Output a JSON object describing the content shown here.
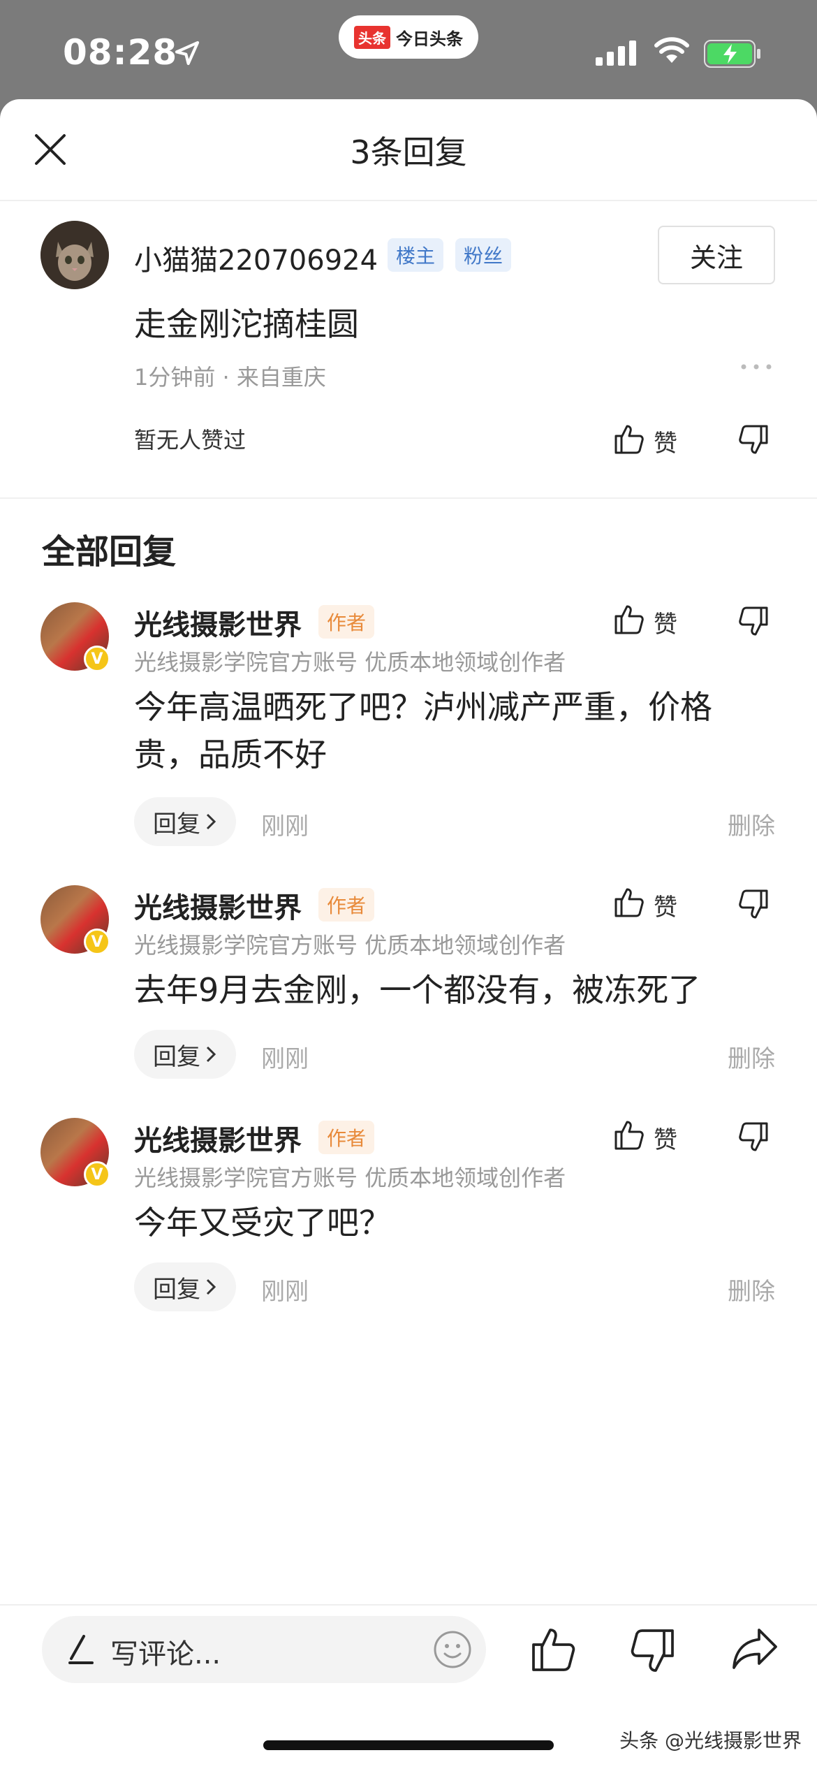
{
  "status_bar": {
    "time": "08:28",
    "app_logo": "头条",
    "app_name": "今日头条"
  },
  "header": {
    "title": "3条回复"
  },
  "main_comment": {
    "user_name": "小猫猫220706924",
    "badges": [
      "楼主",
      "粉丝"
    ],
    "follow_label": "关注",
    "text": "走金刚沱摘桂圆",
    "meta": "1分钟前 · 来自重庆",
    "no_likes": "暂无人赞过",
    "like_label": "赞"
  },
  "section_title": "全部回复",
  "replies": [
    {
      "user_name": "光线摄影世界",
      "badge": "作者",
      "author_desc": "光线摄影学院官方账号 优质本地领域创作者",
      "text": "今年高温晒死了吧？泸州减产严重，价格贵，品质不好",
      "text_line1": "今年高温晒死了吧？泸州减产严重，价格",
      "text_line2": "贵，品质不好",
      "reply_label": "回复",
      "time": "刚刚",
      "delete_label": "删除",
      "like_label": "赞"
    },
    {
      "user_name": "光线摄影世界",
      "badge": "作者",
      "author_desc": "光线摄影学院官方账号 优质本地领域创作者",
      "text": "去年9月去金刚，一个都没有，被冻死了",
      "reply_label": "回复",
      "time": "刚刚",
      "delete_label": "删除",
      "like_label": "赞"
    },
    {
      "user_name": "光线摄影世界",
      "badge": "作者",
      "author_desc": "光线摄影学院官方账号 优质本地领域创作者",
      "text": "今年又受灾了吧？",
      "reply_label": "回复",
      "time": "刚刚",
      "delete_label": "删除",
      "like_label": "赞"
    }
  ],
  "bottom_bar": {
    "input_placeholder": "写评论..."
  },
  "watermark": "头条 @光线摄影世界",
  "colors": {
    "status_bg": "#7b7b7b",
    "author_badge": "#e88a3a",
    "blue_badge": "#4178c8",
    "verified": "#f5c518"
  }
}
